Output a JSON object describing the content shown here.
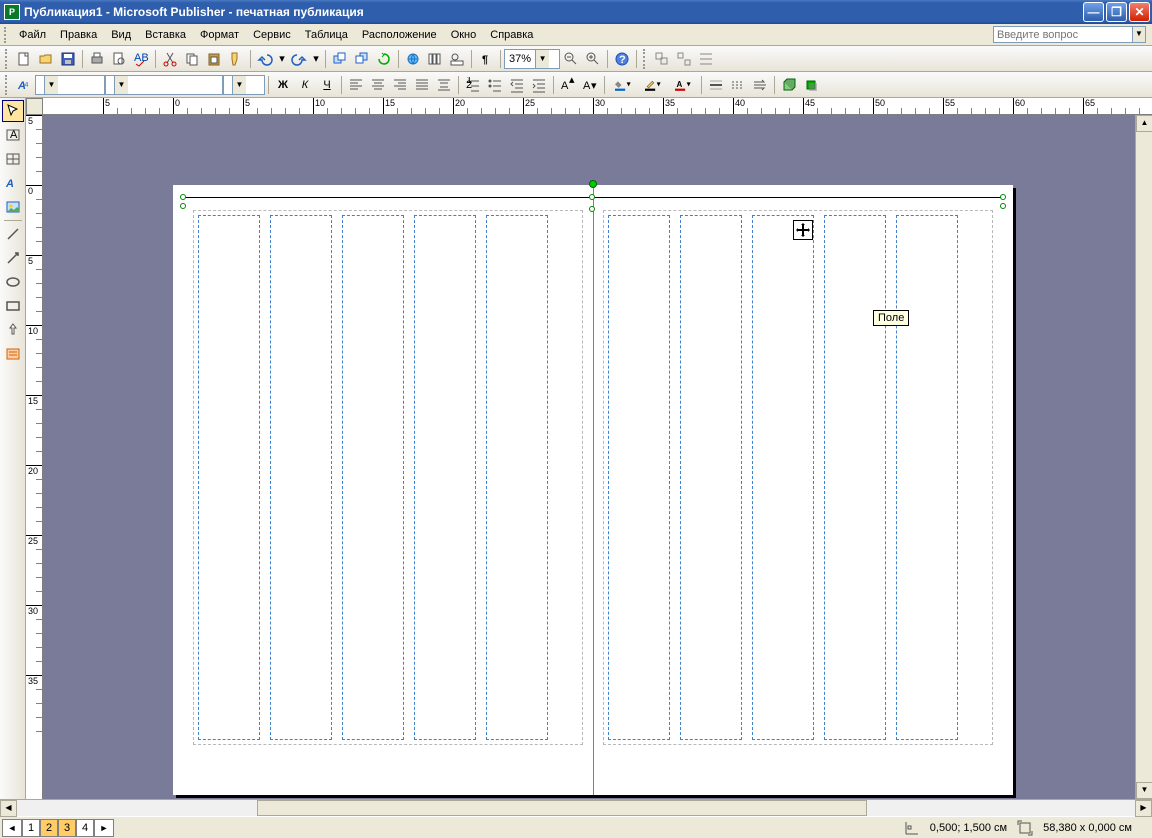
{
  "title": "Публикация1 - Microsoft Publisher - печатная публикация",
  "menu": [
    "Файл",
    "Правка",
    "Вид",
    "Вставка",
    "Формат",
    "Сервис",
    "Таблица",
    "Расположение",
    "Окно",
    "Справка"
  ],
  "help_placeholder": "Введите вопрос",
  "zoom": "37%",
  "tooltip": "Поле",
  "page_tabs": [
    "1",
    "2",
    "3",
    "4"
  ],
  "active_pages": [
    "2",
    "3"
  ],
  "status": {
    "pos": "0,500; 1,500 см",
    "size": "58,380 x  0,000 см"
  },
  "ruler_h_major": [
    -5,
    0,
    5,
    10,
    15,
    20,
    25,
    30,
    35,
    40,
    45,
    50,
    55,
    60,
    65
  ],
  "ruler_v_major": [
    -5,
    0,
    5,
    10,
    15,
    20,
    25,
    30,
    35
  ]
}
